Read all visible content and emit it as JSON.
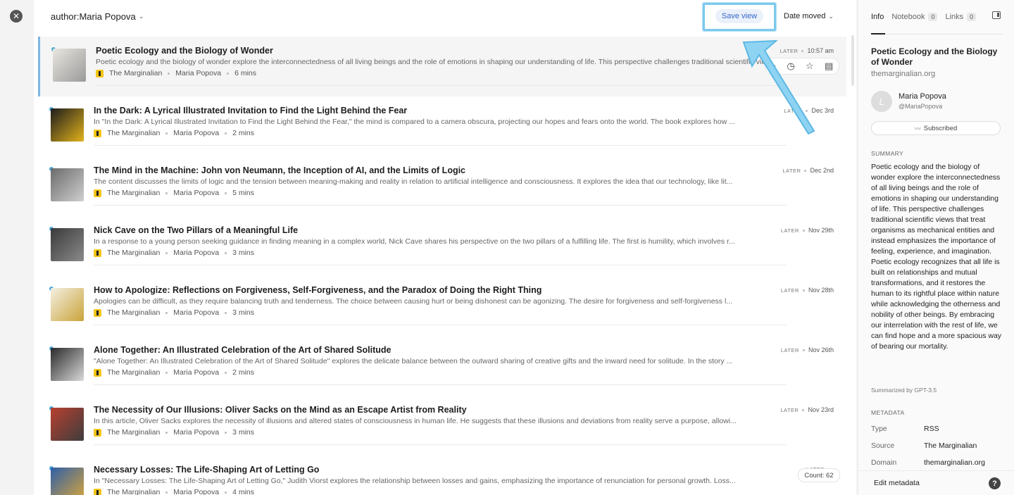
{
  "header": {
    "query": "author:Maria Popova",
    "save_view": "Save view",
    "sort": "Date moved"
  },
  "articles": [
    {
      "title": "Poetic Ecology and the Biology of Wonder",
      "desc": "Poetic ecology and the biology of wonder explore the interconnectedness of all living beings and the role of emotions in shaping our understanding of life. This perspective challenges traditional scientific views that treat organisms as mechanical entities",
      "source": "The Marginalian",
      "author": "Maria Popova",
      "read_time": "6 mins",
      "status": "LATER",
      "date": "10:57 am",
      "thumb_colors": [
        "#e9e6df",
        "#9a9a9a"
      ]
    },
    {
      "title": "In the Dark: A Lyrical Illustrated Invitation to Find the Light Behind the Fear",
      "desc": "In \"In the Dark: A Lyrical Illustrated Invitation to Find the Light Behind the Fear,\" the mind is compared to a camera obscura, projecting our hopes and fears onto the world. The book explores how ...",
      "source": "The Marginalian",
      "author": "Maria Popova",
      "read_time": "2 mins",
      "status": "LATER",
      "date": "Dec 3rd",
      "thumb_colors": [
        "#1c1c1c",
        "#e2b21c"
      ]
    },
    {
      "title": "The Mind in the Machine: John von Neumann, the Inception of AI, and the Limits of Logic",
      "desc": "The content discusses the limits of logic and the tension between meaning-making and reality in relation to artificial intelligence and consciousness. It explores the idea that our technology, like lit...",
      "source": "The Marginalian",
      "author": "Maria Popova",
      "read_time": "5 mins",
      "status": "LATER",
      "date": "Dec 2nd",
      "thumb_colors": [
        "#6b6b6b",
        "#cfcfcf"
      ]
    },
    {
      "title": "Nick Cave on the Two Pillars of a Meaningful Life",
      "desc": "In a response to a young person seeking guidance in finding meaning in a complex world, Nick Cave shares his perspective on the two pillars of a fulfilling life. The first is humility, which involves r...",
      "source": "The Marginalian",
      "author": "Maria Popova",
      "read_time": "3 mins",
      "status": "LATER",
      "date": "Nov 29th",
      "thumb_colors": [
        "#3a3a3a",
        "#8a8a8a"
      ]
    },
    {
      "title": "How to Apologize: Reflections on Forgiveness, Self-Forgiveness, and the Paradox of Doing the Right Thing",
      "desc": "Apologies can be difficult, as they require balancing truth and tenderness. The choice between causing hurt or being dishonest can be agonizing. The desire for forgiveness and self-forgiveness l...",
      "source": "The Marginalian",
      "author": "Maria Popova",
      "read_time": "3 mins",
      "status": "LATER",
      "date": "Nov 28th",
      "thumb_colors": [
        "#f4efe2",
        "#c9a43a"
      ]
    },
    {
      "title": "Alone Together: An Illustrated Celebration of the Art of Shared Solitude",
      "desc": "\"Alone Together: An Illustrated Celebration of the Art of Shared Solitude\" explores the delicate balance between the outward sharing of creative gifts and the inward need for solitude. In the story ...",
      "source": "The Marginalian",
      "author": "Maria Popova",
      "read_time": "2 mins",
      "status": "LATER",
      "date": "Nov 26th",
      "thumb_colors": [
        "#2a2a2a",
        "#d9d9d9"
      ]
    },
    {
      "title": "The Necessity of Our Illusions: Oliver Sacks on the Mind as an Escape Artist from Reality",
      "desc": "In this article, Oliver Sacks explores the necessity of illusions and altered states of consciousness in human life. He suggests that these illusions and deviations from reality serve a purpose, allowi...",
      "source": "The Marginalian",
      "author": "Maria Popova",
      "read_time": "3 mins",
      "status": "LATER",
      "date": "Nov 23rd",
      "thumb_colors": [
        "#b8402f",
        "#3d3d3d"
      ]
    },
    {
      "title": "Necessary Losses: The Life-Shaping Art of Letting Go",
      "desc": "In \"Necessary Losses: The Life-Shaping Art of Letting Go,\" Judith Viorst explores the relationship between losses and gains, emphasizing the importance of renunciation for personal growth. Loss...",
      "source": "The Marginalian",
      "author": "Maria Popova",
      "read_time": "4 mins",
      "status": "LATER",
      "date": "",
      "thumb_colors": [
        "#2f5fa8",
        "#d8a53a"
      ]
    }
  ],
  "count_badge": "Count: 62",
  "panel": {
    "tabs": [
      {
        "label": "Info",
        "count": ""
      },
      {
        "label": "Notebook",
        "count": "0"
      },
      {
        "label": "Links",
        "count": "0"
      }
    ],
    "title": "Poetic Ecology and the Biology of Wonder",
    "domain": "themarginalian.org",
    "avatar_letter": "L",
    "author_name": "Maria Popova",
    "author_handle": "@MariaPopova",
    "subscribed": "Subscribed",
    "summary_label": "SUMMARY",
    "summary": "Poetic ecology and the biology of wonder explore the interconnectedness of all living beings and the role of emotions in shaping our understanding of life. This perspective challenges traditional scientific views that treat organisms as mechanical entities and instead emphasizes the importance of feeling, experience, and imagination. Poetic ecology recognizes that all life is built on relationships and mutual transformations, and it restores the human to its rightful place within nature while acknowledging the otherness and nobility of other beings. By embracing our interrelation with the rest of life, we can find hope and a more spacious way of bearing our mortality.",
    "summarized_by": "Summarized by GPT-3.5",
    "metadata_label": "METADATA",
    "metadata": [
      {
        "key": "Type",
        "value": "RSS"
      },
      {
        "key": "Source",
        "value": "The Marginalian"
      },
      {
        "key": "Domain",
        "value": "themarginalian.org"
      }
    ],
    "edit_metadata": "Edit metadata",
    "help": "?"
  },
  "colors": {
    "accent": "#3766c8",
    "unread_dot": "#4aa8d8",
    "highlight": "#7cc9ee",
    "source_icon": "#f5c518"
  },
  "icons": {
    "close": "close-icon",
    "chevron": "chevron-down-icon",
    "rss": "rss-icon",
    "snooze": "clock-icon",
    "star": "star-icon",
    "archive": "archive-icon",
    "panel": "sidebar-toggle-icon"
  }
}
